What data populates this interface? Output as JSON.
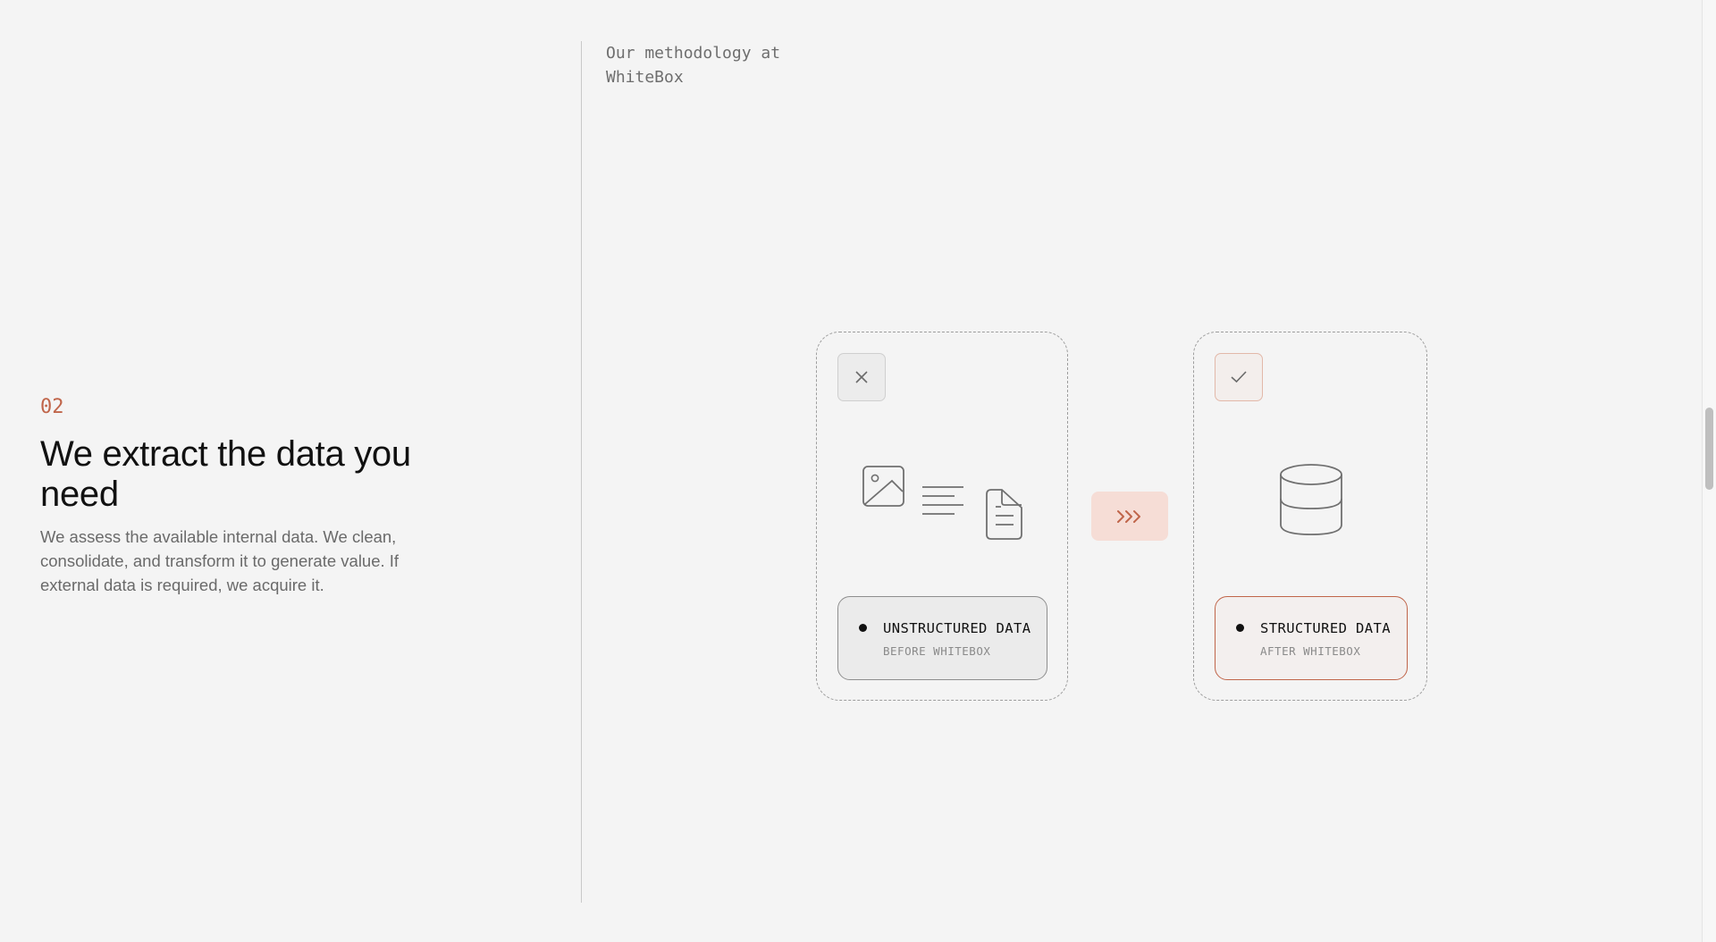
{
  "section": {
    "eyebrow": "Our methodology at WhiteBox",
    "step_number": "02",
    "heading": "We extract the data you need",
    "description": "We assess the available internal data. We clean, consolidate, and transform it to generate value. If external data is required, we acquire it."
  },
  "diagram": {
    "before": {
      "status_icon": "close-icon",
      "icons": [
        "image-icon",
        "text-lines-icon",
        "document-icon"
      ],
      "title": "UNSTRUCTURED DATA",
      "subtitle": "BEFORE WHITEBOX"
    },
    "transition": {
      "icon": "triple-chevron-right-icon",
      "color": "#c0654a"
    },
    "after": {
      "status_icon": "check-icon",
      "icons": [
        "database-icon"
      ],
      "title": "STRUCTURED DATA",
      "subtitle": "AFTER WHITEBOX"
    }
  },
  "colors": {
    "background": "#f4f4f4",
    "accent": "#c0654a",
    "accent_soft": "#f6ddd6",
    "text_primary": "#111111",
    "text_secondary": "#6a6a6a"
  }
}
